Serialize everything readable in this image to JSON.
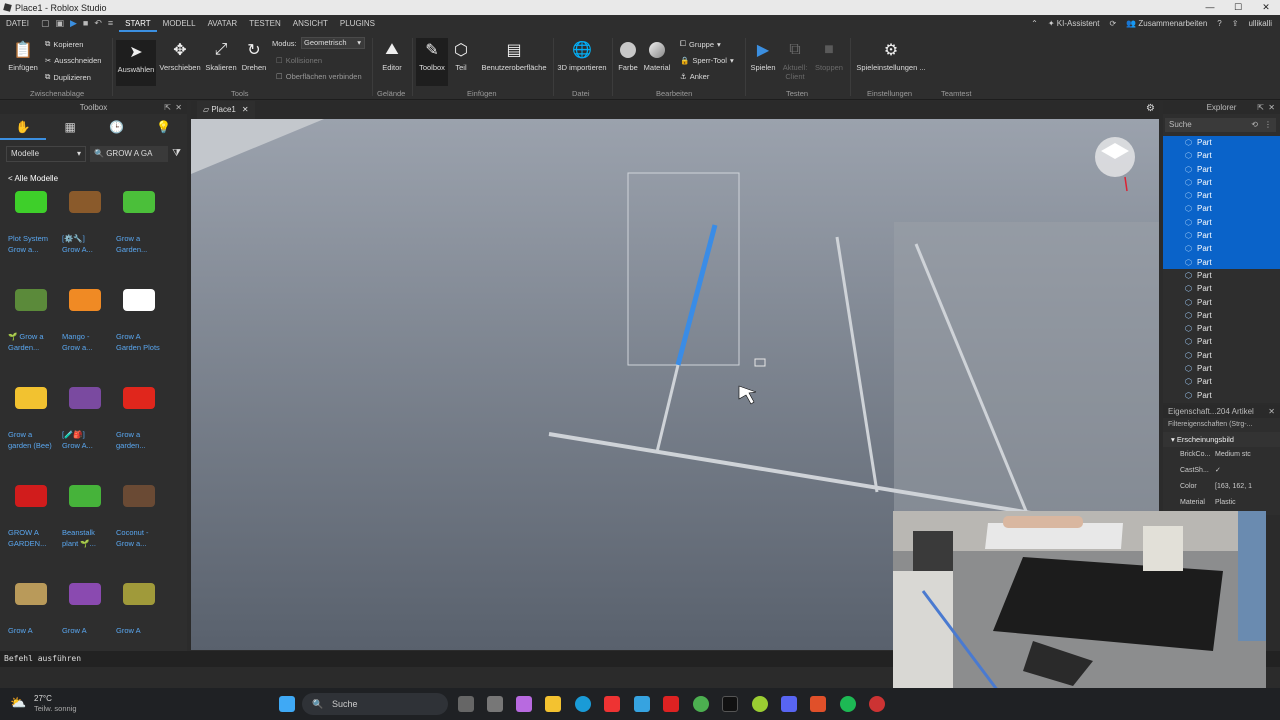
{
  "window": {
    "title": "Place1 - Roblox Studio"
  },
  "menubar": {
    "items": [
      "DATEI",
      "START",
      "MODELL",
      "AVATAR",
      "TESTEN",
      "ANSICHT",
      "PLUGINS"
    ],
    "active": "START",
    "ai_assistant": "KI-Assistent",
    "collaborate": "Zusammenarbeiten",
    "user": "ullikalli"
  },
  "ribbon": {
    "einfuegen": "Einfügen",
    "kopieren": "Kopieren",
    "ausschneiden": "Ausschneiden",
    "duplizieren": "Duplizieren",
    "zwischenablage": "Zwischenablage",
    "auswaehlen": "Auswählen",
    "verschieben": "Verschieben",
    "skalieren": "Skalieren",
    "drehen": "Drehen",
    "modus_label": "Modus:",
    "modus_value": "Geometrisch",
    "kollisionen": "Kollisionen",
    "oberflaechen": "Oberflächen verbinden",
    "tools": "Tools",
    "editor": "Editor",
    "gelaende": "Gelände",
    "toolbox": "Toolbox",
    "teil": "Teil",
    "benutzeroberflaeche": "Benutzeroberfläche",
    "einfuegen_group": "Einfügen",
    "importieren": "3D importieren",
    "datei": "Datei",
    "farbe": "Farbe",
    "material": "Material",
    "gruppe": "Gruppe",
    "sperr_tool": "Sperr-Tool",
    "anker": "Anker",
    "bearbeiten": "Bearbeiten",
    "spielen": "Spielen",
    "aktuell_client": "Aktuell: Client",
    "stoppen": "Stoppen",
    "testen": "Testen",
    "spieleinstellungen": "Spieleinstellungen ...",
    "einstellungen": "Einstellungen",
    "teamtest": "Teamtest"
  },
  "toolbox": {
    "title": "Toolbox",
    "category": "Modelle",
    "search_value": "GROW A GA",
    "all_models": "< Alle Modelle",
    "items": [
      {
        "l1": "Plot System",
        "l2": "Grow a...",
        "color": "#3ecf2a",
        "icon": "plot-icon"
      },
      {
        "l1": "[⚙️🔧]",
        "l2": "Grow A...",
        "color": "#8a5a2b",
        "icon": "gear-icon"
      },
      {
        "l1": "Grow a",
        "l2": "Garden...",
        "color": "#4bbf3a",
        "icon": "garden-icon"
      },
      {
        "l1": "🌱 Grow a",
        "l2": "Garden...",
        "color": "#5b8a3a",
        "icon": "bed-icon"
      },
      {
        "l1": "Mango -",
        "l2": "Grow a...",
        "color": "#f08a24",
        "icon": "mango-icon"
      },
      {
        "l1": "Grow A",
        "l2": "Garden Plots",
        "color": "#ffffff",
        "icon": "code-icon"
      },
      {
        "l1": "Grow a",
        "l2": "garden (Bee)",
        "color": "#f2c230",
        "icon": "bee-icon"
      },
      {
        "l1": "[🧪🎒]",
        "l2": "Grow A...",
        "color": "#7a4aa0",
        "icon": "crate-icon"
      },
      {
        "l1": "Grow a",
        "l2": "garden...",
        "color": "#e0261c",
        "icon": "pepper-icon"
      },
      {
        "l1": "GROW A",
        "l2": "GARDEN...",
        "color": "#d11c1c",
        "icon": "fruit-icon"
      },
      {
        "l1": "Beanstalk",
        "l2": "plant 🌱...",
        "color": "#46b33a",
        "icon": "beanstalk-icon"
      },
      {
        "l1": "Coconut -",
        "l2": "Grow a...",
        "color": "#6a4a34",
        "icon": "coconut-icon"
      },
      {
        "l1": "Grow A",
        "l2": "Garden Pe...",
        "color": "#b99a5a",
        "icon": "table-icon"
      },
      {
        "l1": "Grow A",
        "l2": "Garden Ge...",
        "color": "#8a4ab0",
        "icon": "gear-stand-icon"
      },
      {
        "l1": "Grow A",
        "l2": "Garden -...",
        "color": "#a09a3a",
        "icon": "seeds-icon"
      }
    ]
  },
  "document": {
    "tab": "Place1"
  },
  "explorer": {
    "title": "Explorer",
    "search_placeholder": "Suche",
    "rows": [
      {
        "label": "Part",
        "selected": true
      },
      {
        "label": "Part",
        "selected": true
      },
      {
        "label": "Part",
        "selected": true
      },
      {
        "label": "Part",
        "selected": true
      },
      {
        "label": "Part",
        "selected": true
      },
      {
        "label": "Part",
        "selected": true
      },
      {
        "label": "Part",
        "selected": true
      },
      {
        "label": "Part",
        "selected": true
      },
      {
        "label": "Part",
        "selected": true
      },
      {
        "label": "Part",
        "selected": true
      },
      {
        "label": "Part",
        "selected": false
      },
      {
        "label": "Part",
        "selected": false
      },
      {
        "label": "Part",
        "selected": false
      },
      {
        "label": "Part",
        "selected": false
      },
      {
        "label": "Part",
        "selected": false
      },
      {
        "label": "Part",
        "selected": false
      },
      {
        "label": "Part",
        "selected": false
      },
      {
        "label": "Part",
        "selected": false
      },
      {
        "label": "Part",
        "selected": false
      },
      {
        "label": "Part",
        "selected": false
      }
    ]
  },
  "properties": {
    "title": "Eigenschaft...204 Artikel",
    "filter": "Filtereigenschaften (Strg-...",
    "section": "Erscheinungsbild",
    "rows": [
      {
        "k": "BrickCo...",
        "v": "Medium stc"
      },
      {
        "k": "CastSh...",
        "v": "✓"
      },
      {
        "k": "Color",
        "v": "[163, 162, 1"
      },
      {
        "k": "Material",
        "v": "Plastic"
      }
    ]
  },
  "command": {
    "placeholder": "Befehl ausführen"
  },
  "taskbar": {
    "temp": "27°C",
    "weather": "Teilw. sonnig",
    "search": "Suche"
  }
}
